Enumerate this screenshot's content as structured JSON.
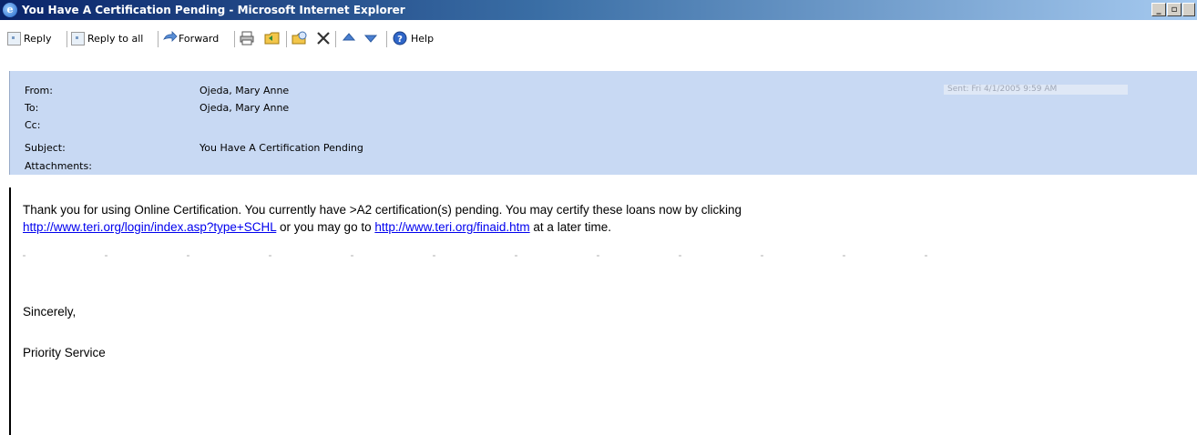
{
  "window": {
    "title": "You Have A Certification Pending - Microsoft Internet Explorer",
    "minimize_glyph": "_",
    "restore_glyph": "▫"
  },
  "toolbar": {
    "reply": "Reply",
    "reply_all": "Reply to all",
    "forward": "Forward",
    "help": "Help",
    "icons": [
      "print-icon",
      "folder-icon",
      "move-icon",
      "delete-icon",
      "up-arrow-icon",
      "down-arrow-icon",
      "help-icon"
    ]
  },
  "header": {
    "from_label": "From:",
    "from_value": "Ojeda, Mary Anne",
    "to_label": "To:",
    "to_value": "Ojeda, Mary Anne",
    "cc_label": "Cc:",
    "cc_value": "",
    "subject_label": "Subject:",
    "subject_value": "You Have A Certification Pending",
    "attachments_label": "Attachments:",
    "sent_text": "Sent:  Fri 4/1/2005 9:59 AM"
  },
  "message": {
    "line1": "Thank you for using Online Certification.  You currently have >A2 certification(s) pending.  You may certify these loans now by clicking",
    "link1": "http://www.teri.org/login/index.asp?type+SCHL",
    "mid": " or you  may go to ",
    "link2": "http://www.teri.org/finaid.htm",
    "end": " at a later time.",
    "closing": "Sincerely,",
    "signature": "Priority Service"
  },
  "colors": {
    "header_bg": "#c8d9f3",
    "link": "#0000ee",
    "titlebar_start": "#0a246a",
    "titlebar_end": "#a6caf0"
  }
}
